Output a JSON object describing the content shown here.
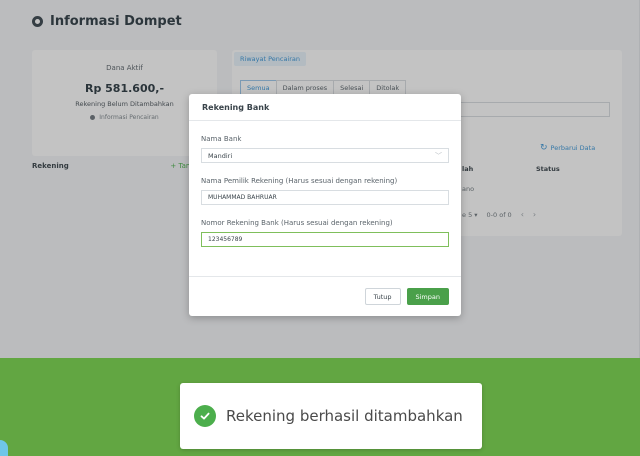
{
  "page": {
    "title": "Informasi Dompet"
  },
  "balance": {
    "label": "Dana Aktif",
    "amount": "Rp 581.600,-",
    "pending": "Rekening Belum Ditambahkan",
    "info_link": "Informasi Pencairan"
  },
  "rekening": {
    "label": "Rekening",
    "add_link": "+ Tambah Re"
  },
  "history": {
    "header_tab": "Riwayat Pencairan",
    "tabs": [
      "Semua",
      "Dalam proses",
      "Selesai",
      "Ditolak"
    ],
    "refresh": "Perbarui Data",
    "col_jumlah": "lah",
    "col_status": "Status",
    "cell": "ano",
    "pager_rows": "e   5 ▾",
    "pager_range": "0-0 of 0"
  },
  "modal": {
    "title": "Rekening Bank",
    "bank_label": "Nama Bank",
    "bank_value": "Mandiri",
    "owner_label": "Nama Pemilik Rekening (Harus sesuai dengan rekening)",
    "owner_value": "MUHAMMAD BAHRUAR",
    "number_label": "Nomor Rekening Bank (Harus sesuai dengan rekening)",
    "number_value": "123456789",
    "close_button": "Tutup",
    "save_button": "Simpan"
  },
  "toast": {
    "message": "Rekening berhasil ditambahkan"
  },
  "colors": {
    "accent_green": "#4aa04a",
    "toast_background": "#62a642",
    "link_blue": "#3c97d8"
  }
}
